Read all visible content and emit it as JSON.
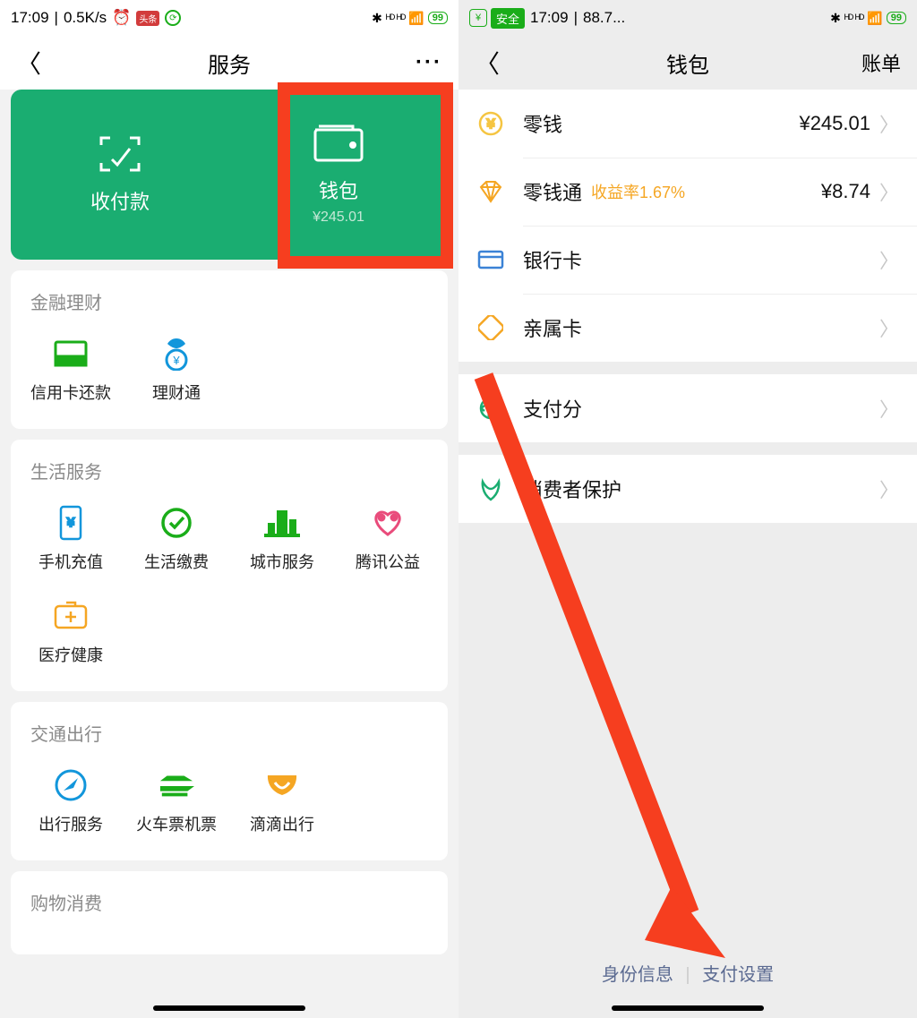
{
  "left": {
    "status": {
      "time": "17:09",
      "speed": "0.5K/s",
      "batt": "99"
    },
    "nav": {
      "title": "服务"
    },
    "green": {
      "pay_label": "收付款",
      "wallet_label": "钱包",
      "wallet_balance": "¥245.01"
    },
    "sections": [
      {
        "title": "金融理财",
        "items": [
          {
            "label": "信用卡还款",
            "icon": "card"
          },
          {
            "label": "理财通",
            "icon": "coin"
          }
        ]
      },
      {
        "title": "生活服务",
        "items": [
          {
            "label": "手机充值",
            "icon": "phone"
          },
          {
            "label": "生活缴费",
            "icon": "check"
          },
          {
            "label": "城市服务",
            "icon": "city"
          },
          {
            "label": "腾讯公益",
            "icon": "heart"
          },
          {
            "label": "医疗健康",
            "icon": "med"
          }
        ]
      },
      {
        "title": "交通出行",
        "items": [
          {
            "label": "出行服务",
            "icon": "nav"
          },
          {
            "label": "火车票机票",
            "icon": "train"
          },
          {
            "label": "滴滴出行",
            "icon": "didi"
          }
        ]
      },
      {
        "title": "购物消费",
        "items": []
      }
    ]
  },
  "right": {
    "status": {
      "safe": "安全",
      "time": "17:09",
      "pct": "88.7...",
      "batt": "99"
    },
    "nav": {
      "title": "钱包",
      "right": "账单"
    },
    "rows1": [
      {
        "icon": "coin-y",
        "label": "零钱",
        "value": "¥245.01"
      },
      {
        "icon": "diamond",
        "label": "零钱通",
        "sub": "收益率1.67%",
        "value": "¥8.74"
      },
      {
        "icon": "card-b",
        "label": "银行卡"
      },
      {
        "icon": "family",
        "label": "亲属卡"
      }
    ],
    "rows2": [
      {
        "icon": "score",
        "label": "支付分"
      }
    ],
    "rows3": [
      {
        "icon": "protect",
        "label": "消费者保护"
      }
    ],
    "bottom": {
      "identity": "身份信息",
      "settings": "支付设置"
    }
  }
}
